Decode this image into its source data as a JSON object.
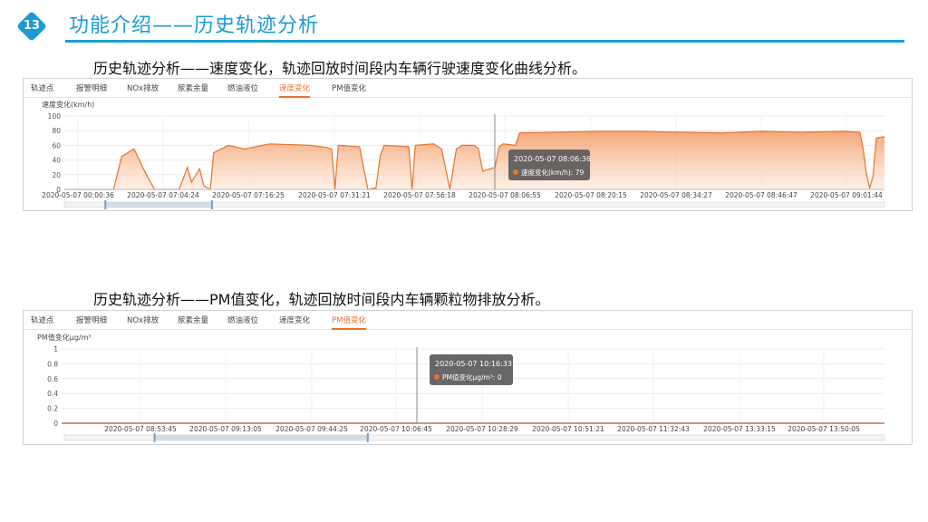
{
  "header": {
    "badge_number": "13",
    "title": "功能介绍——历史轨迹分析"
  },
  "tabs": [
    "轨迹点",
    "报警明细",
    "NOx排放",
    "尿素余量",
    "燃油液位",
    "速度变化",
    "PM值变化"
  ],
  "panels": [
    {
      "caption": "历史轨迹分析——速度变化，轨迹回放时间段内车辆行驶速度变化曲线分析。",
      "active_tab": "速度变化",
      "tooltip": {
        "time": "2020-05-07 08:06:36",
        "series_label": "速度变化(km/h): 79"
      },
      "slider": {
        "start": 0.05,
        "end": 0.18
      }
    },
    {
      "caption": "历史轨迹分析——PM值变化，轨迹回放时间段内车辆颗粒物排放分析。",
      "active_tab": "PM值变化",
      "tooltip": {
        "time": "2020-05-07 10:16:33",
        "series_label": "PM值变化μg/m³: 0"
      },
      "slider": {
        "start": 0.11,
        "end": 0.37
      }
    }
  ],
  "chart_data": [
    {
      "type": "area",
      "ylabel": "速度变化(km/h)",
      "ylim": [
        0,
        100
      ],
      "yticks": [
        0,
        20,
        40,
        60,
        80,
        100
      ],
      "xticks": [
        "2020-05-07 00:00:36",
        "2020-05-07 07:04:24",
        "2020-05-07 07:16:25",
        "2020-05-07 07:31:21",
        "2020-05-07 07:56:18",
        "2020-05-07 08:06:55",
        "2020-05-07 08:20:15",
        "2020-05-07 08:34:27",
        "2020-05-07 08:46:47",
        "2020-05-07 09:01:44"
      ],
      "series": [
        {
          "color": "#e8722c",
          "points": [
            [
              0,
              0
            ],
            [
              0.6,
              0
            ],
            [
              0.7,
              45
            ],
            [
              0.85,
              55
            ],
            [
              1.0,
              20
            ],
            [
              1.1,
              0
            ],
            [
              1.4,
              0
            ],
            [
              1.5,
              30
            ],
            [
              1.55,
              10
            ],
            [
              1.65,
              28
            ],
            [
              1.7,
              5
            ],
            [
              1.78,
              0
            ],
            [
              1.82,
              50
            ],
            [
              2.0,
              60
            ],
            [
              2.2,
              55
            ],
            [
              2.5,
              62
            ],
            [
              3.0,
              60
            ],
            [
              3.2,
              57
            ],
            [
              3.26,
              55
            ],
            [
              3.3,
              0
            ],
            [
              3.34,
              60
            ],
            [
              3.6,
              58
            ],
            [
              3.7,
              0
            ],
            [
              3.8,
              2
            ],
            [
              3.85,
              45
            ],
            [
              3.9,
              60
            ],
            [
              4.2,
              58
            ],
            [
              4.24,
              0
            ],
            [
              4.28,
              60
            ],
            [
              4.5,
              62
            ],
            [
              4.6,
              55
            ],
            [
              4.7,
              0
            ],
            [
              4.78,
              55
            ],
            [
              4.85,
              60
            ],
            [
              5.0,
              60
            ],
            [
              5.05,
              55
            ],
            [
              5.1,
              25
            ],
            [
              5.25,
              30
            ],
            [
              5.3,
              58
            ],
            [
              5.35,
              62
            ],
            [
              5.5,
              60
            ],
            [
              5.55,
              77
            ],
            [
              6.0,
              78
            ],
            [
              6.5,
              79
            ],
            [
              7.0,
              79
            ],
            [
              7.5,
              78
            ],
            [
              8.0,
              77
            ],
            [
              8.5,
              79
            ],
            [
              9.0,
              78
            ],
            [
              9.5,
              79
            ],
            [
              9.7,
              78
            ],
            [
              9.74,
              55
            ],
            [
              9.78,
              20
            ],
            [
              9.82,
              2
            ],
            [
              9.86,
              18
            ],
            [
              9.9,
              70
            ],
            [
              10.0,
              72
            ]
          ]
        }
      ]
    },
    {
      "type": "line",
      "ylabel": "PM值变化μg/m³",
      "ylim": [
        0,
        1
      ],
      "yticks": [
        0,
        0.2,
        0.4,
        0.6,
        0.8,
        1
      ],
      "xticks": [
        "2020-05-07 08:53:45",
        "2020-05-07 09:13:05",
        "2020-05-07 09:44:25",
        "2020-05-07 10:06:45",
        "2020-05-07 10:28:29",
        "2020-05-07 10:51:21",
        "2020-05-07 11:32:43",
        "2020-05-07 13:33:15",
        "2020-05-07 13:50:05"
      ],
      "series": [
        {
          "color": "#e8722c",
          "points": [
            [
              0,
              0
            ],
            [
              10,
              0
            ]
          ]
        }
      ]
    }
  ]
}
